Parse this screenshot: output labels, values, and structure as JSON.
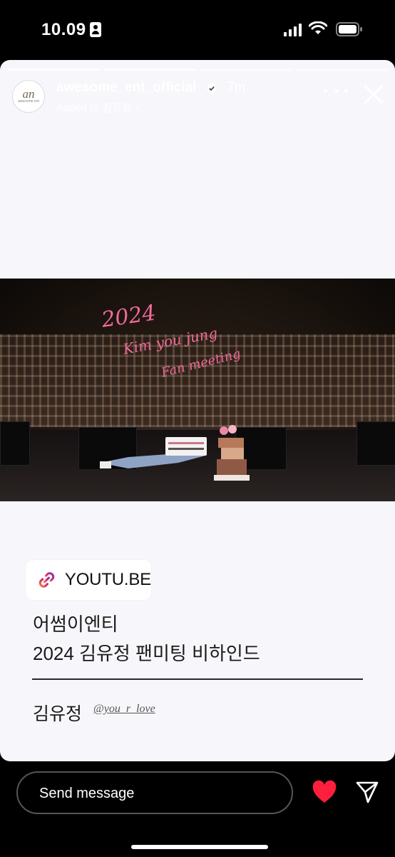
{
  "status_bar": {
    "time": "10.09",
    "icons": [
      "id-card-icon",
      "signal-icon",
      "wifi-icon",
      "battery-icon"
    ]
  },
  "story": {
    "progress_segments": 4,
    "active_segment": 1,
    "header": {
      "username": "awesome_ent_official",
      "time_ago": "7m",
      "added_to": "Added to 김유정",
      "avatar_logo": "an",
      "avatar_text": "awesome ent"
    },
    "photo": {
      "overlay_title_lines": [
        "2024",
        "Kim you jung",
        "Fan meeting"
      ],
      "title_color": "#f06a9a"
    },
    "link_sticker": {
      "label": "YOUTU.BE",
      "icon": "link-icon",
      "gradient": [
        "#f58529",
        "#dd2a7b",
        "#8134af"
      ]
    },
    "caption": {
      "line1": "어썸이엔티",
      "line2": "2024 김유정 팬미팅 비하인드"
    },
    "credit": {
      "name": "김유정",
      "handle": "@you_r_love"
    }
  },
  "bottom_bar": {
    "message_placeholder": "Send message",
    "like_color": "#ff1f3d"
  }
}
